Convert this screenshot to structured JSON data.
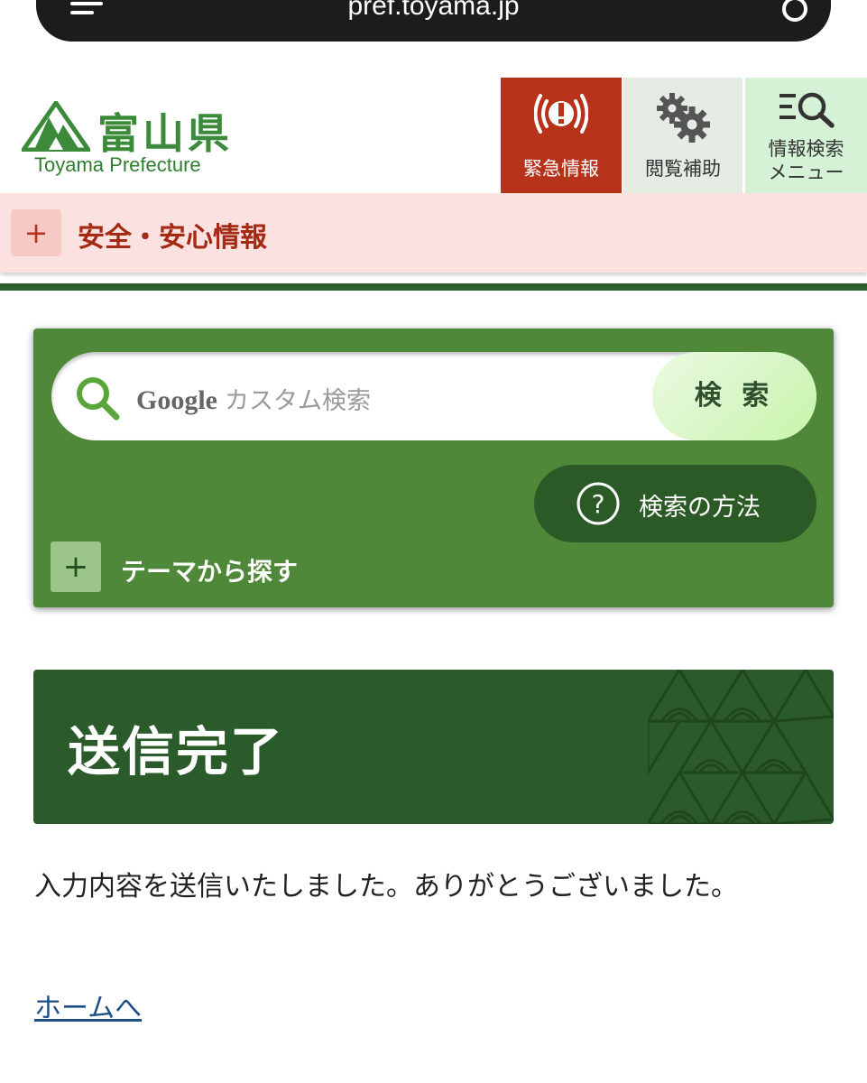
{
  "browser": {
    "url": "pref.toyama.jp"
  },
  "header": {
    "logo_kanji": "富山県",
    "logo_sub": "Toyama Prefecture",
    "emergency_label": "緊急情報",
    "accessibility_label": "閲覧補助",
    "search_menu_label_1": "情報検索",
    "search_menu_label_2": "メニュー"
  },
  "safety": {
    "label": "安全・安心情報",
    "plus": "+"
  },
  "search": {
    "brand": "Google",
    "placeholder": "カスタム検索",
    "button_label": "検 索",
    "how_label": "検索の方法",
    "theme_label": "テーマから探す",
    "theme_plus": "+"
  },
  "page": {
    "title": "送信完了",
    "message": "入力内容を送信いたしました。ありがとうございました。",
    "home_link": "ホームへ"
  },
  "colors": {
    "brand_green": "#4e8838",
    "dark_green": "#2b5a2b",
    "emergency_red": "#b7321a",
    "safety_pink": "#fbe1e0",
    "link_blue": "#1d4f86"
  },
  "icons": [
    "menu-icon",
    "reload-icon",
    "mountain-logo-icon",
    "alert-icon",
    "gears-icon",
    "search-menu-icon",
    "plus-icon",
    "search-icon",
    "question-icon"
  ]
}
